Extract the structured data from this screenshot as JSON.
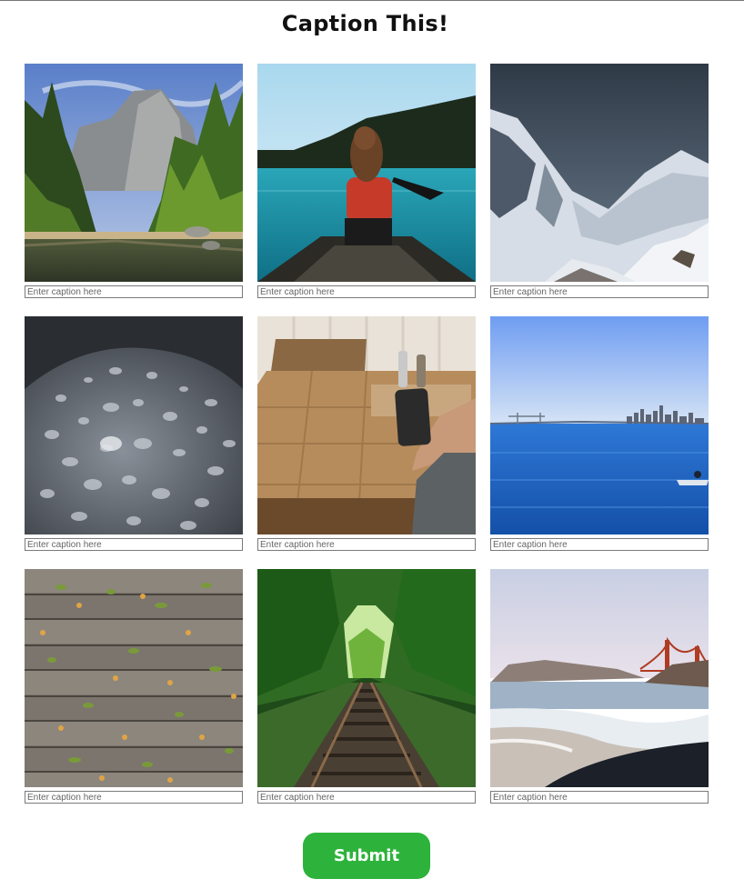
{
  "page": {
    "title": "Caption This!"
  },
  "photos": [
    {
      "subject": "mountain-forest-river",
      "caption_placeholder": "Enter caption here",
      "caption_value": ""
    },
    {
      "subject": "woman-in-canoe-lake",
      "caption_placeholder": "Enter caption here",
      "caption_value": ""
    },
    {
      "subject": "snowy-mountains",
      "caption_placeholder": "Enter caption here",
      "caption_value": ""
    },
    {
      "subject": "water-droplets-surface",
      "caption_placeholder": "Enter caption here",
      "caption_value": ""
    },
    {
      "subject": "hand-holding-phone-table",
      "caption_placeholder": "Enter caption here",
      "caption_value": ""
    },
    {
      "subject": "bay-city-skyline-boat",
      "caption_placeholder": "Enter caption here",
      "caption_value": ""
    },
    {
      "subject": "wood-planks-leaves",
      "caption_placeholder": "Enter caption here",
      "caption_value": ""
    },
    {
      "subject": "railway-track-forest",
      "caption_placeholder": "Enter caption here",
      "caption_value": ""
    },
    {
      "subject": "beach-golden-gate-bridge",
      "caption_placeholder": "Enter caption here",
      "caption_value": ""
    }
  ],
  "actions": {
    "submit_label": "Submit"
  },
  "colors": {
    "submit_button": "#2db33b",
    "input_border": "#7a7a7a",
    "title_text": "#111111"
  }
}
